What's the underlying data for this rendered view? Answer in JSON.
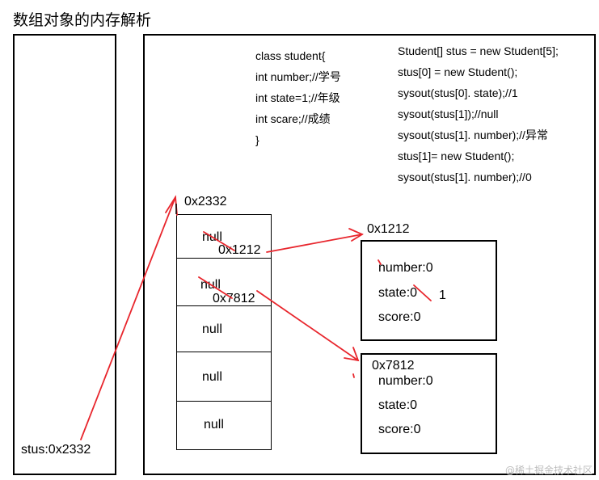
{
  "title": "数组对象的内存解析",
  "stack": {
    "var_label": "stus:0x2332"
  },
  "class_def": {
    "lines": [
      "class student{",
      "int number;//学号",
      "int state=1;//年级",
      "int scare;//成绩",
      "}"
    ]
  },
  "code": {
    "lines": [
      "Student[] stus = new Student[5];",
      "stus[0] = new Student();",
      "sysout(stus[0]. state);//1",
      "sysout(stus[1]);//null",
      "sysout(stus[1]. number);//异常",
      "stus[1]= new Student();",
      "sysout(stus[1]. number);//0"
    ]
  },
  "array": {
    "address": "0x2332",
    "cells": [
      "null",
      "null",
      "null",
      "null",
      "null"
    ],
    "cell0_value": "0x1212",
    "cell1_value": "0x7812"
  },
  "object1": {
    "address": "0x1212",
    "fields": [
      "number:0",
      "state:0",
      "score:0"
    ],
    "updated_state": "1"
  },
  "object2": {
    "address": "0x7812",
    "fields": [
      "number:0",
      "state:0",
      "score:0"
    ]
  },
  "watermark": "@稀土掘金技术社区",
  "colors": {
    "arrow": "#e8262d",
    "border": "#000000"
  }
}
